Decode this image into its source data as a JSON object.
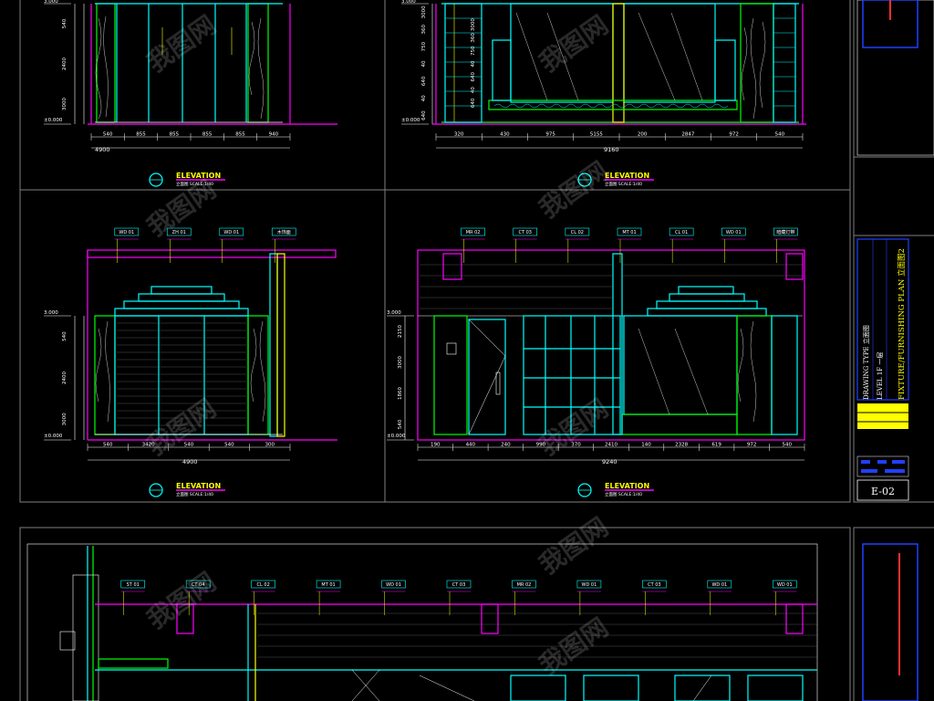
{
  "colors": {
    "background": "#000000",
    "magenta": "#ff00ff",
    "cyan": "#00ffff",
    "green": "#00ff00",
    "yellow": "#ffff00",
    "white": "#ffffff",
    "red": "#ff3030",
    "blue": "#2040ff",
    "border_gray": "#7f7f7f"
  },
  "watermark": "我图网",
  "level_datum": "±0.000",
  "level_top": "3.000",
  "elevation_label": "ELEVATION",
  "elevation_scale": "立面图 SCALE:1/40",
  "views": [
    {
      "dims_vertical": [
        "540",
        "2400",
        "3000"
      ],
      "dims_horizontal": [
        "540",
        "855",
        "855",
        "855",
        "855",
        "940"
      ],
      "dim_total": "4900"
    },
    {
      "dims_vertical": [
        "3000",
        "360",
        "750",
        "40",
        "640",
        "40",
        "640"
      ],
      "dims_horizontal": [
        "320",
        "430",
        "975",
        "5155",
        "200",
        "2847",
        "972",
        "540"
      ],
      "dim_total": "9160"
    },
    {
      "tags": [
        "WD 01",
        "ZH 01",
        "WD 01",
        "木饰面"
      ],
      "dims_vertical": [
        "540",
        "2400",
        "3000"
      ],
      "dims_horizontal": [
        "540",
        "3420",
        "540",
        "540",
        "300"
      ],
      "dim_total": "4900"
    },
    {
      "tags": [
        "MR 02",
        "CT 03",
        "CL 02",
        "MT 01",
        "CL 01",
        "WD 01",
        "暗藏灯带"
      ],
      "dims_vertical": [
        "2150",
        "3000",
        "1860",
        "540"
      ],
      "dims_horizontal": [
        "190",
        "440",
        "240",
        "990",
        "370",
        "2410",
        "140",
        "2328",
        "619",
        "972",
        "540"
      ],
      "dim_total": "9240"
    },
    {
      "tags": [
        "ST 01",
        "CT 04",
        "CL 02",
        "MT 01",
        "WD 01",
        "CT 03",
        "MR 02",
        "WD 01",
        "CT 03",
        "WD 01",
        "WD 01"
      ]
    }
  ],
  "title_block": {
    "drawing_type": "DRAWING TYPE 立面图",
    "level": "LEVEL 1F 一层",
    "title": "FIXTURE/FURNISHING PLAN 立面图2",
    "sheet_no": "E-02"
  }
}
